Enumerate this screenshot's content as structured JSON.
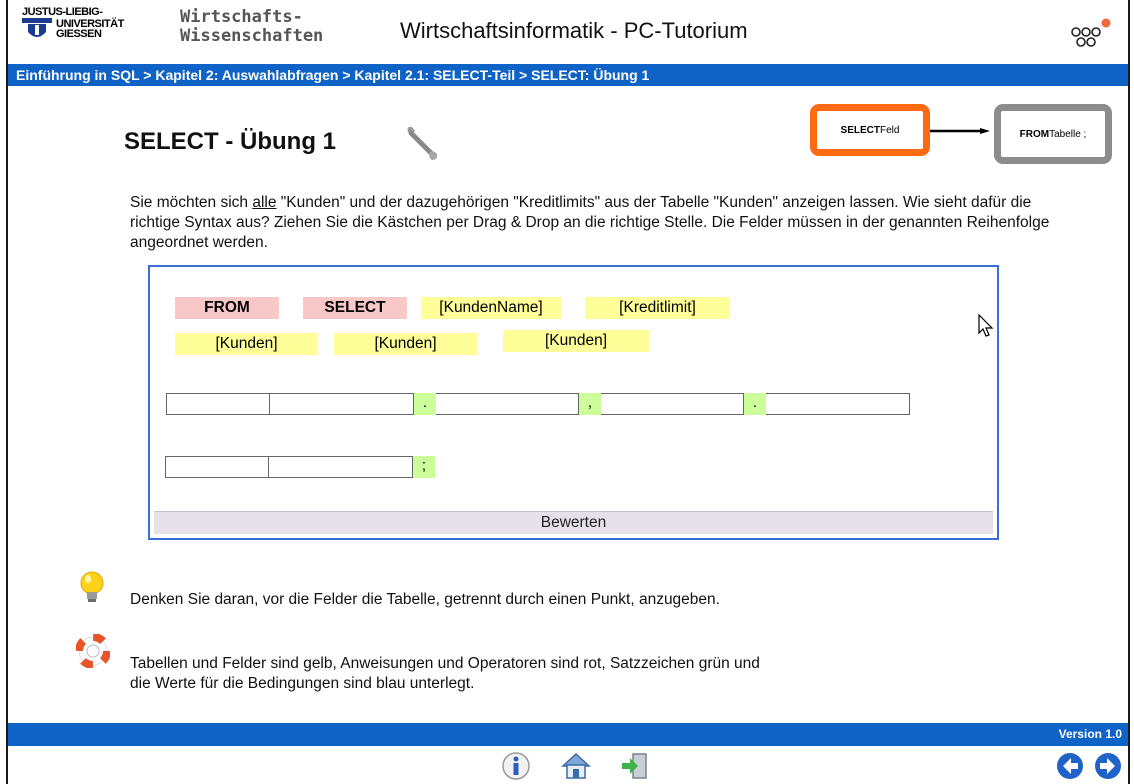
{
  "header": {
    "uni_line1": "JUSTUS-LIEBIG-",
    "uni_line2": "UNIVERSITÄT",
    "uni_line3": "GIESSEN",
    "faculty_line1": "Wirtschafts-",
    "faculty_line2": "Wissenschaften",
    "title": "Wirtschaftsinformatik - PC-Tutorium",
    "logo_icon": "circles-logo-icon"
  },
  "breadcrumb": "Einführung in SQL > Kapitel 2: Auswahlabfragen > Kapitel 2.1: SELECT-Teil > SELECT: Übung 1",
  "page": {
    "title": "SELECT - Übung 1",
    "icon": "wrench-icon",
    "flow": {
      "select_keyword": "SELECT",
      "select_rest": " Feld",
      "from_keyword": "FROM",
      "from_rest": " Tabelle ;"
    },
    "instructions_pre": "Sie möchten sich ",
    "instructions_underlined": "alle",
    "instructions_post": " \"Kunden\" und der dazugehörigen \"Kreditlimits\" aus der Tabelle \"Kunden\" anzeigen lassen. Wie sieht dafür die richtige Syntax aus? Ziehen Sie die Kästchen per Drag & Drop an die richtige Stelle. Die Felder müssen in der genannten Reihenfolge angeordnet werden."
  },
  "exercise": {
    "tiles": {
      "from": "FROM",
      "select": "SELECT",
      "kundenname": "[KundenName]",
      "kreditlimit": "[Kreditlimit]",
      "kunden1": "[Kunden]",
      "kunden2": "[Kunden]",
      "kunden3": "[Kunden]"
    },
    "separators": {
      "dot1": ".",
      "comma": ",",
      "dot2": ".",
      "semicolon": ";"
    },
    "evaluate_label": "Bewerten"
  },
  "hint": {
    "icon": "lightbulb-icon",
    "text": "Denken Sie daran, vor die Felder die Tabelle, getrennt durch einen Punkt, anzugeben."
  },
  "help": {
    "icon": "lifebuoy-icon",
    "line1": "Tabellen und Felder sind gelb, Anweisungen und Operatoren sind rot, Satzzeichen grün und",
    "line2": "die Werte für die Bedingungen sind blau unterlegt."
  },
  "footer": {
    "version": "Version 1.0",
    "icons": [
      "info-icon",
      "home-icon",
      "exit-icon",
      "back-arrow-icon",
      "forward-arrow-icon"
    ]
  },
  "colors": {
    "accent_blue": "#0f63c7",
    "tile_red": "#f8c7c7",
    "tile_yellow": "#ffff99",
    "separator_green": "#ccff99",
    "flow_orange": "#ff6a13"
  }
}
